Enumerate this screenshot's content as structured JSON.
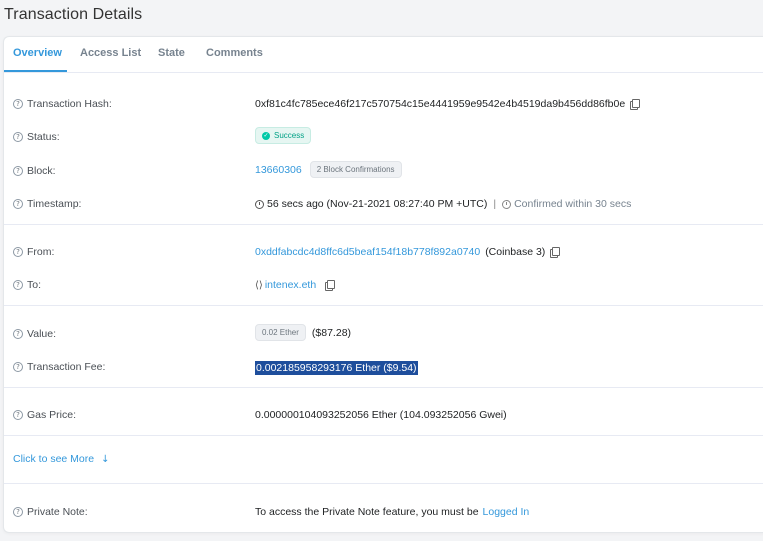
{
  "page_title": "Transaction Details",
  "tabs": [
    {
      "label": "Overview",
      "active": true
    },
    {
      "label": "Access List",
      "active": false
    },
    {
      "label": "State",
      "active": false
    },
    {
      "label": "Comments",
      "active": false
    }
  ],
  "rows": {
    "hash": {
      "label": "Transaction Hash:",
      "value": "0xf81c4fc785ece46f217c570754c15e4441959e9542e4b4519da9b456dd86fb0e"
    },
    "status": {
      "label": "Status:",
      "value": "Success"
    },
    "block": {
      "label": "Block:",
      "value": "13660306",
      "confirmations": "2 Block Confirmations"
    },
    "timestamp": {
      "label": "Timestamp:",
      "value": "56 secs ago (Nov-21-2021 08:27:40 PM +UTC)",
      "separator": "|",
      "confirmed": "Confirmed within 30 secs"
    },
    "from": {
      "label": "From:",
      "value": "0xddfabcdc4d8ffc6d5beaf154f18b778f892a0740",
      "note": "(Coinbase 3)"
    },
    "to": {
      "label": "To:",
      "value": "intenex.eth"
    },
    "value": {
      "label": "Value:",
      "badge": "0.02 Ether",
      "usd": "($87.28)"
    },
    "fee": {
      "label": "Transaction Fee:",
      "value": "0.002185958293176 Ether ($9.54)"
    },
    "gas_price": {
      "label": "Gas Price:",
      "value": "0.000000104093252056 Ether (104.093252056 Gwei)"
    },
    "private_note": {
      "label": "Private Note:",
      "text": "To access the Private Note feature, you must be",
      "link": "Logged In"
    }
  },
  "more_link": "Click to see More",
  "colors": {
    "accent": "#3498db",
    "success": "#00c9a7",
    "selection": "#1e4e9c"
  },
  "icons": {
    "help": "question-circle-icon",
    "copy": "copy-icon",
    "clock": "clock-icon",
    "check": "check-circle-icon",
    "contract": "code-icon",
    "arrow": "arrow-down-icon"
  }
}
